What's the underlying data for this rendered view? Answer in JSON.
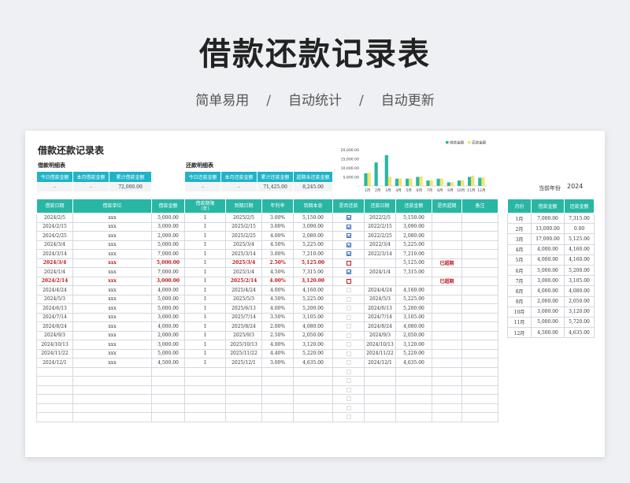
{
  "hero": {
    "title": "借款还款记录表",
    "subtitle": [
      "简单易用",
      "自动统计",
      "自动更新"
    ],
    "separator": "/"
  },
  "sheet": {
    "title": "借款还款记录表",
    "loan_detail_label": "借款明细表",
    "repay_detail_label": "还款明细表",
    "loan_summary": {
      "headers": [
        "今日借款金额",
        "本月借款金额",
        "累计借款金额"
      ],
      "values": [
        "-",
        "-",
        "72,000.00"
      ]
    },
    "repay_summary": {
      "headers": [
        "今日还款金额",
        "本月还款金额",
        "累计还款金额",
        "超期未还款金额"
      ],
      "values": [
        "-",
        "-",
        "71,425.00",
        "8,245.00"
      ]
    },
    "current_year_label": "当前年份",
    "current_year": "2024",
    "colors": {
      "teal": "#28b7a4",
      "blue": "#1fb3c8",
      "yellow": "#f7e36b",
      "overdue": "#c01a1a"
    }
  },
  "main_table": {
    "headers": [
      "借款日期",
      "借款单位",
      "借款金额",
      "借款期限\n（年）",
      "到期日期",
      "年利率",
      "到期本息",
      "是否还款",
      "还款日期",
      "还款金额",
      "是否超期",
      "备注"
    ],
    "rows": [
      {
        "date": "2024/2/5",
        "unit": "xxx",
        "amount": "5,000.00",
        "term": "1",
        "due": "2025/2/5",
        "rate": "3.00%",
        "total": "5,150.00",
        "repaid": "checked",
        "repay_date": "2022/2/5",
        "repay_amount": "5,150.00",
        "overdue": "",
        "note": ""
      },
      {
        "date": "2024/2/15",
        "unit": "xxx",
        "amount": "3,000.00",
        "term": "1",
        "due": "2025/2/15",
        "rate": "3.00%",
        "total": "3,090.00",
        "repaid": "checked",
        "repay_date": "2022/2/15",
        "repay_amount": "3,090.00",
        "overdue": "",
        "note": ""
      },
      {
        "date": "2024/2/25",
        "unit": "xxx",
        "amount": "2,000.00",
        "term": "1",
        "due": "2025/2/25",
        "rate": "4.00%",
        "total": "2,080.00",
        "repaid": "checked",
        "repay_date": "2022/2/25",
        "repay_amount": "2,080.00",
        "overdue": "",
        "note": ""
      },
      {
        "date": "2024/3/4",
        "unit": "xxx",
        "amount": "5,000.00",
        "term": "1",
        "due": "2025/3/4",
        "rate": "4.50%",
        "total": "5,225.00",
        "repaid": "checked",
        "repay_date": "2022/3/4",
        "repay_amount": "5,225.00",
        "overdue": "",
        "note": ""
      },
      {
        "date": "2024/3/14",
        "unit": "xxx",
        "amount": "7,000.00",
        "term": "1",
        "due": "2025/3/14",
        "rate": "3.00%",
        "total": "7,210.00",
        "repaid": "checked",
        "repay_date": "2022/3/14",
        "repay_amount": "7,210.00",
        "overdue": "",
        "note": ""
      },
      {
        "date": "2024/3/4",
        "unit": "xxx",
        "amount": "5,000.00",
        "term": "1",
        "due": "2025/3/4",
        "rate": "2.50%",
        "total": "5,125.00",
        "repaid": "red",
        "repay_date": "",
        "repay_amount": "5,125.00",
        "overdue": "已超期",
        "note": "",
        "red": true
      },
      {
        "date": "2024/1/4",
        "unit": "xxx",
        "amount": "7,000.00",
        "term": "1",
        "due": "2025/1/4",
        "rate": "4.50%",
        "total": "7,315.00",
        "repaid": "checked",
        "repay_date": "2024/1/4",
        "repay_amount": "7,315.00",
        "overdue": "",
        "note": ""
      },
      {
        "date": "2024/2/14",
        "unit": "xxx",
        "amount": "3,000.00",
        "term": "1",
        "due": "2025/2/14",
        "rate": "4.00%",
        "total": "3,120.00",
        "repaid": "red",
        "repay_date": "",
        "repay_amount": "",
        "overdue": "已超期",
        "note": "",
        "red": true
      },
      {
        "date": "2024/4/24",
        "unit": "xxx",
        "amount": "4,000.00",
        "term": "1",
        "due": "2025/4/24",
        "rate": "4.00%",
        "total": "4,160.00",
        "repaid": "faint",
        "repay_date": "2024/4/24",
        "repay_amount": "4,160.00",
        "overdue": "",
        "note": ""
      },
      {
        "date": "2024/5/3",
        "unit": "xxx",
        "amount": "5,000.00",
        "term": "1",
        "due": "2025/5/3",
        "rate": "4.50%",
        "total": "5,225.00",
        "repaid": "faint",
        "repay_date": "2024/5/3",
        "repay_amount": "5,225.00",
        "overdue": "",
        "note": ""
      },
      {
        "date": "2024/6/13",
        "unit": "xxx",
        "amount": "5,000.00",
        "term": "1",
        "due": "2025/6/13",
        "rate": "4.00%",
        "total": "5,200.00",
        "repaid": "faint",
        "repay_date": "2024/6/13",
        "repay_amount": "5,200.00",
        "overdue": "",
        "note": ""
      },
      {
        "date": "2024/7/14",
        "unit": "xxx",
        "amount": "3,000.00",
        "term": "1",
        "due": "2025/7/14",
        "rate": "3.50%",
        "total": "3,105.00",
        "repaid": "faint",
        "repay_date": "2024/7/14",
        "repay_amount": "3,105.00",
        "overdue": "",
        "note": ""
      },
      {
        "date": "2024/8/24",
        "unit": "xxx",
        "amount": "4,000.00",
        "term": "1",
        "due": "2025/8/24",
        "rate": "2.00%",
        "total": "4,080.00",
        "repaid": "faint",
        "repay_date": "2024/8/24",
        "repay_amount": "4,080.00",
        "overdue": "",
        "note": ""
      },
      {
        "date": "2024/9/3",
        "unit": "xxx",
        "amount": "2,000.00",
        "term": "1",
        "due": "2025/9/3",
        "rate": "2.50%",
        "total": "2,050.00",
        "repaid": "faint",
        "repay_date": "2024/9/3",
        "repay_amount": "2,050.00",
        "overdue": "",
        "note": ""
      },
      {
        "date": "2024/10/13",
        "unit": "xxx",
        "amount": "3,000.00",
        "term": "1",
        "due": "2025/10/13",
        "rate": "4.00%",
        "total": "3,120.00",
        "repaid": "faint",
        "repay_date": "2024/10/13",
        "repay_amount": "3,120.00",
        "overdue": "",
        "note": ""
      },
      {
        "date": "2024/11/22",
        "unit": "xxx",
        "amount": "5,000.00",
        "term": "1",
        "due": "2025/11/22",
        "rate": "4.40%",
        "total": "5,220.00",
        "repaid": "faint",
        "repay_date": "2024/11/22",
        "repay_amount": "5,220.00",
        "overdue": "",
        "note": ""
      },
      {
        "date": "2024/12/1",
        "unit": "xxx",
        "amount": "4,500.00",
        "term": "1",
        "due": "2025/12/1",
        "rate": "3.00%",
        "total": "4,635.00",
        "repaid": "faint",
        "repay_date": "2024/12/1",
        "repay_amount": "4,635.00",
        "overdue": "",
        "note": ""
      }
    ],
    "empty_rows": 6
  },
  "month_table": {
    "headers": [
      "月份",
      "借款金额",
      "还款金额"
    ],
    "rows": [
      [
        "1月",
        "7,000.00",
        "7,315.00"
      ],
      [
        "2月",
        "13,000.00",
        "0.00"
      ],
      [
        "3月",
        "17,000.00",
        "5,125.00"
      ],
      [
        "4月",
        "4,000.00",
        "4,160.00"
      ],
      [
        "5月",
        "4,000.00",
        "4,160.00"
      ],
      [
        "6月",
        "5,000.00",
        "5,200.00"
      ],
      [
        "7月",
        "3,000.00",
        "3,105.00"
      ],
      [
        "8月",
        "4,000.00",
        "4,080.00"
      ],
      [
        "9月",
        "2,000.00",
        "2,050.00"
      ],
      [
        "10月",
        "3,000.00",
        "3,120.00"
      ],
      [
        "11月",
        "5,000.00",
        "5,720.00"
      ],
      [
        "12月",
        "4,500.00",
        "4,635.00"
      ]
    ]
  },
  "chart_data": {
    "type": "bar",
    "categories": [
      "1月",
      "2月",
      "3月",
      "4月",
      "5月",
      "6月",
      "7月",
      "8月",
      "9月",
      "10月",
      "11月",
      "12月"
    ],
    "series": [
      {
        "name": "借款金额",
        "values": [
          7000,
          13000,
          17000,
          4000,
          4000,
          5000,
          3000,
          4000,
          2000,
          3000,
          5000,
          4500
        ],
        "color": "#28b7a4"
      },
      {
        "name": "还款金额",
        "values": [
          7315,
          0,
          5125,
          4160,
          4160,
          5200,
          3105,
          4080,
          2050,
          3120,
          5720,
          4635
        ],
        "color": "#f7e36b"
      }
    ],
    "yticks": [
      "20,000.00",
      "15,000.00",
      "10,000.00",
      "5,000.00",
      "-"
    ],
    "ylim": [
      0,
      20000
    ],
    "legend": "top-right",
    "grid": false
  }
}
